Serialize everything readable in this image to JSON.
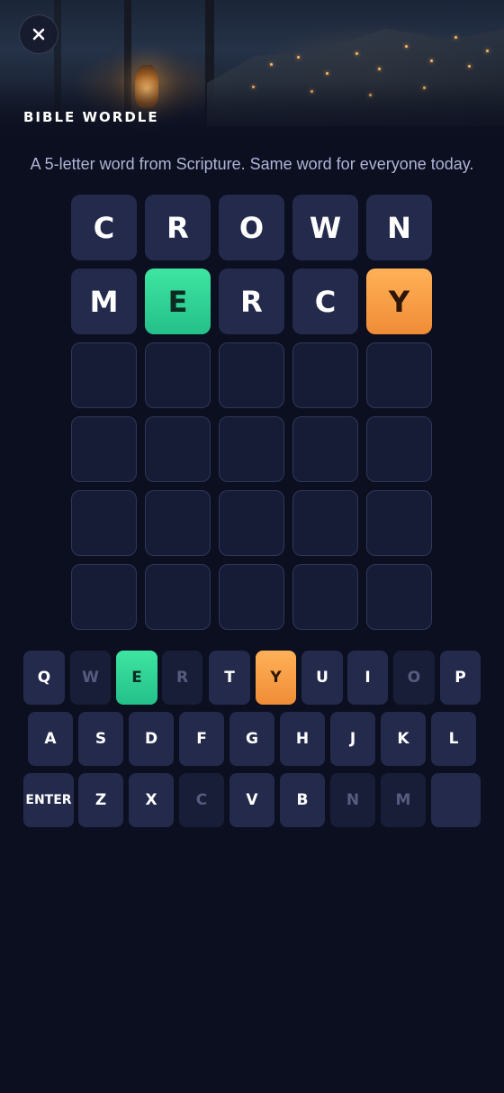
{
  "header": {
    "title": "BIBLE WORDLE",
    "close_icon": "close-icon"
  },
  "subtitle": "A 5-letter word from Scripture. Same word for everyone today.",
  "board": {
    "rows": [
      [
        {
          "letter": "C",
          "state": "filled"
        },
        {
          "letter": "R",
          "state": "filled"
        },
        {
          "letter": "O",
          "state": "filled"
        },
        {
          "letter": "W",
          "state": "filled"
        },
        {
          "letter": "N",
          "state": "filled"
        }
      ],
      [
        {
          "letter": "M",
          "state": "filled"
        },
        {
          "letter": "E",
          "state": "correct"
        },
        {
          "letter": "R",
          "state": "filled"
        },
        {
          "letter": "C",
          "state": "filled"
        },
        {
          "letter": "Y",
          "state": "present"
        }
      ],
      [
        {
          "letter": "",
          "state": "empty"
        },
        {
          "letter": "",
          "state": "empty"
        },
        {
          "letter": "",
          "state": "empty"
        },
        {
          "letter": "",
          "state": "empty"
        },
        {
          "letter": "",
          "state": "empty"
        }
      ],
      [
        {
          "letter": "",
          "state": "empty"
        },
        {
          "letter": "",
          "state": "empty"
        },
        {
          "letter": "",
          "state": "empty"
        },
        {
          "letter": "",
          "state": "empty"
        },
        {
          "letter": "",
          "state": "empty"
        }
      ],
      [
        {
          "letter": "",
          "state": "empty"
        },
        {
          "letter": "",
          "state": "empty"
        },
        {
          "letter": "",
          "state": "empty"
        },
        {
          "letter": "",
          "state": "empty"
        },
        {
          "letter": "",
          "state": "empty"
        }
      ],
      [
        {
          "letter": "",
          "state": "empty"
        },
        {
          "letter": "",
          "state": "empty"
        },
        {
          "letter": "",
          "state": "empty"
        },
        {
          "letter": "",
          "state": "empty"
        },
        {
          "letter": "",
          "state": "empty"
        }
      ]
    ]
  },
  "keyboard": {
    "rows": [
      [
        {
          "key": "Q",
          "state": "unused"
        },
        {
          "key": "W",
          "state": "absent"
        },
        {
          "key": "E",
          "state": "correct"
        },
        {
          "key": "R",
          "state": "absent"
        },
        {
          "key": "T",
          "state": "unused"
        },
        {
          "key": "Y",
          "state": "present"
        },
        {
          "key": "U",
          "state": "unused"
        },
        {
          "key": "I",
          "state": "unused"
        },
        {
          "key": "O",
          "state": "absent"
        },
        {
          "key": "P",
          "state": "unused"
        }
      ],
      [
        {
          "key": "A",
          "state": "unused"
        },
        {
          "key": "S",
          "state": "unused"
        },
        {
          "key": "D",
          "state": "unused"
        },
        {
          "key": "F",
          "state": "unused"
        },
        {
          "key": "G",
          "state": "unused"
        },
        {
          "key": "H",
          "state": "unused"
        },
        {
          "key": "J",
          "state": "unused"
        },
        {
          "key": "K",
          "state": "unused"
        },
        {
          "key": "L",
          "state": "unused"
        }
      ],
      [
        {
          "key": "ENTER",
          "state": "unused"
        },
        {
          "key": "Z",
          "state": "unused"
        },
        {
          "key": "X",
          "state": "unused"
        },
        {
          "key": "C",
          "state": "absent"
        },
        {
          "key": "V",
          "state": "unused"
        },
        {
          "key": "B",
          "state": "unused"
        },
        {
          "key": "N",
          "state": "absent"
        },
        {
          "key": "M",
          "state": "absent"
        },
        {
          "key": "",
          "state": "unused",
          "icon": "backspace-key"
        }
      ]
    ]
  },
  "colors": {
    "correct": "#2fd497",
    "present": "#f9a047",
    "tile": "#242a4c",
    "background": "#0c0f20"
  }
}
